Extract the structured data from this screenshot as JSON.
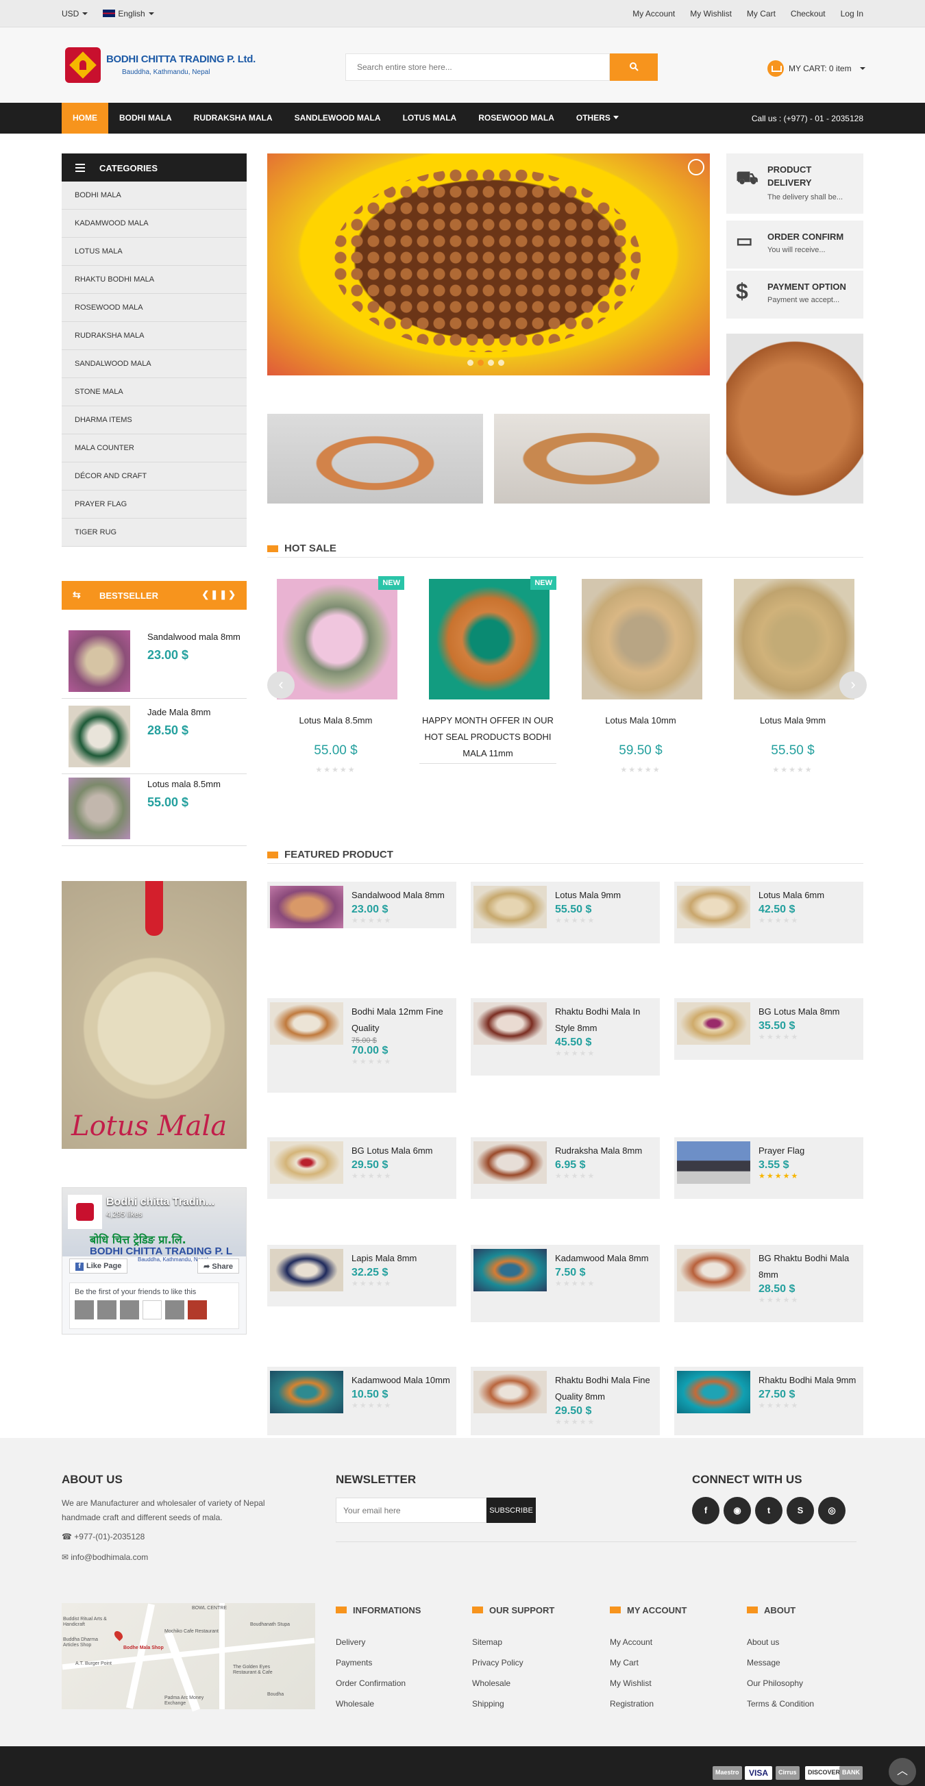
{
  "topbar": {
    "currency": "USD",
    "language": "English",
    "links": [
      "My Account",
      "My Wishlist",
      "My Cart",
      "Checkout",
      "Log In"
    ]
  },
  "header": {
    "logo_title": "BODHI CHITTA TRADING P. Ltd.",
    "logo_sub": "Bauddha, Kathmandu, Nepal",
    "search_placeholder": "Search entire store here...",
    "cart_label": "MY CART: 0 item"
  },
  "nav": {
    "items": [
      "HOME",
      "BODHI MALA",
      "RUDRAKSHA MALA",
      "SANDLEWOOD MALA",
      "LOTUS MALA",
      "ROSEWOOD MALA",
      "OTHERS"
    ],
    "call": "Call us : (+977) - 01 - 2035128"
  },
  "categories": {
    "title": "CATEGORIES",
    "items": [
      "BODHI MALA",
      "KADAMWOOD MALA",
      "LOTUS MALA",
      "RHAKTU BODHI MALA",
      "ROSEWOOD MALA",
      "RUDRAKSHA MALA",
      "SANDALWOOD MALA",
      "STONE MALA",
      "DHARMA ITEMS",
      "MALA COUNTER",
      "DÉCOR AND CRAFT",
      "PRAYER FLAG",
      "TIGER RUG"
    ]
  },
  "bestseller": {
    "title": "BESTSELLER",
    "items": [
      {
        "name": "Sandalwood mala 8mm",
        "price": "23.00 $"
      },
      {
        "name": "Jade Mala 8mm",
        "price": "28.50 $"
      },
      {
        "name": "Lotus mala 8.5mm",
        "price": "55.00 $"
      }
    ]
  },
  "side_banner_text": "Lotus Mala",
  "facebook": {
    "page_name": "Bodhi chitta Tradin...",
    "likes": "4,295 likes",
    "cover_text": "बोधि चित्त ट्रेडिङ प्रा.लि.",
    "cover_company": "BODHI CHITTA TRADING P. L",
    "cover_sub": "Bauddha, Kathmandu, Nepal",
    "like_btn": "Like Page",
    "share_btn": "Share",
    "friends_text": "Be the first of your friends to like this"
  },
  "services": [
    {
      "title": "PRODUCT DELIVERY",
      "desc": "The delivery shall be..."
    },
    {
      "title": "ORDER CONFIRM",
      "desc": "You will receive..."
    },
    {
      "title": "PAYMENT OPTION",
      "desc": "Payment we accept..."
    }
  ],
  "hot_sale": {
    "title": "HOT SALE",
    "badge": "NEW",
    "items": [
      {
        "name": "Lotus Mala 8.5mm",
        "price": "55.00 $"
      },
      {
        "name": "HAPPY MONTH OFFER IN OUR HOT SEAL PRODUCTS BODHI MALA 11mm",
        "price": ""
      },
      {
        "name": "Lotus Mala 10mm",
        "price": "59.50 $"
      },
      {
        "name": "Lotus Mala 9mm",
        "price": "55.50 $"
      }
    ]
  },
  "featured": {
    "title": "FEATURED PRODUCT",
    "items": [
      {
        "name": "Sandalwood Mala 8mm",
        "price": "23.00 $"
      },
      {
        "name": "Lotus Mala 9mm",
        "price": "55.50 $"
      },
      {
        "name": "Lotus Mala 6mm",
        "price": "42.50 $"
      },
      {
        "name": "Bodhi Mala 12mm Fine Quality",
        "old_price": "75.00 $",
        "price": "70.00 $"
      },
      {
        "name": "Rhaktu Bodhi Mala In Style 8mm",
        "price": "45.50 $"
      },
      {
        "name": "BG Lotus Mala 8mm",
        "price": "35.50 $"
      },
      {
        "name": "BG Lotus Mala 6mm",
        "price": "29.50 $"
      },
      {
        "name": "Rudraksha Mala 8mm",
        "price": "6.95 $"
      },
      {
        "name": "Prayer Flag",
        "price": "3.55 $"
      },
      {
        "name": "Lapis Mala 8mm",
        "price": "32.25 $"
      },
      {
        "name": "Kadamwood Mala 8mm",
        "price": "7.50 $"
      },
      {
        "name": "BG Rhaktu Bodhi Mala 8mm",
        "price": "28.50 $"
      },
      {
        "name": "Kadamwood Mala 10mm",
        "price": "10.50 $"
      },
      {
        "name": "Rhaktu Bodhi Mala Fine Quality 8mm",
        "price": "29.50 $"
      },
      {
        "name": "Rhaktu Bodhi Mala 9mm",
        "price": "27.50 $"
      }
    ]
  },
  "footer": {
    "about_title": "ABOUT US",
    "about_text": "We are Manufacturer and wholesaler of variety of Nepal handmade craft and different seeds of mala.",
    "phone": "+977-(01)-2035128",
    "email": "info@bodhimala.com",
    "newsletter_title": "NEWSLETTER",
    "newsletter_placeholder": "Your email here",
    "subscribe": "SUBSCRIBE",
    "connect_title": "CONNECT WITH US",
    "map_labels": [
      "Buddist Ritual Arts & Handicraft",
      "Buddha Dharma Articles Shop",
      "A.T. Burger Point",
      "Bodhe Mala Shop",
      "Mochiko Cafe Restaurant",
      "BOWL CENTRE",
      "Boudhanath Stupa",
      "The Golden Eyes Restaurant & Cafe",
      "Boudha",
      "Padma Arc Money Exchange"
    ],
    "columns": [
      {
        "title": "INFORMATIONS",
        "links": [
          "Delivery",
          "Payments",
          "Order Confirmation",
          "Wholesale"
        ]
      },
      {
        "title": "OUR SUPPORT",
        "links": [
          "Sitemap",
          "Privacy Policy",
          "Wholesale",
          "Shipping"
        ]
      },
      {
        "title": "MY ACCOUNT",
        "links": [
          "My Account",
          "My Cart",
          "My Wishlist",
          "Registration"
        ]
      },
      {
        "title": "ABOUT",
        "links": [
          "About us",
          "Message",
          "Our Philosophy",
          "Terms & Condition"
        ]
      }
    ],
    "payments": [
      "Maestro",
      "VISA",
      "Cirrus",
      "DISCOVER",
      "BANK"
    ]
  }
}
